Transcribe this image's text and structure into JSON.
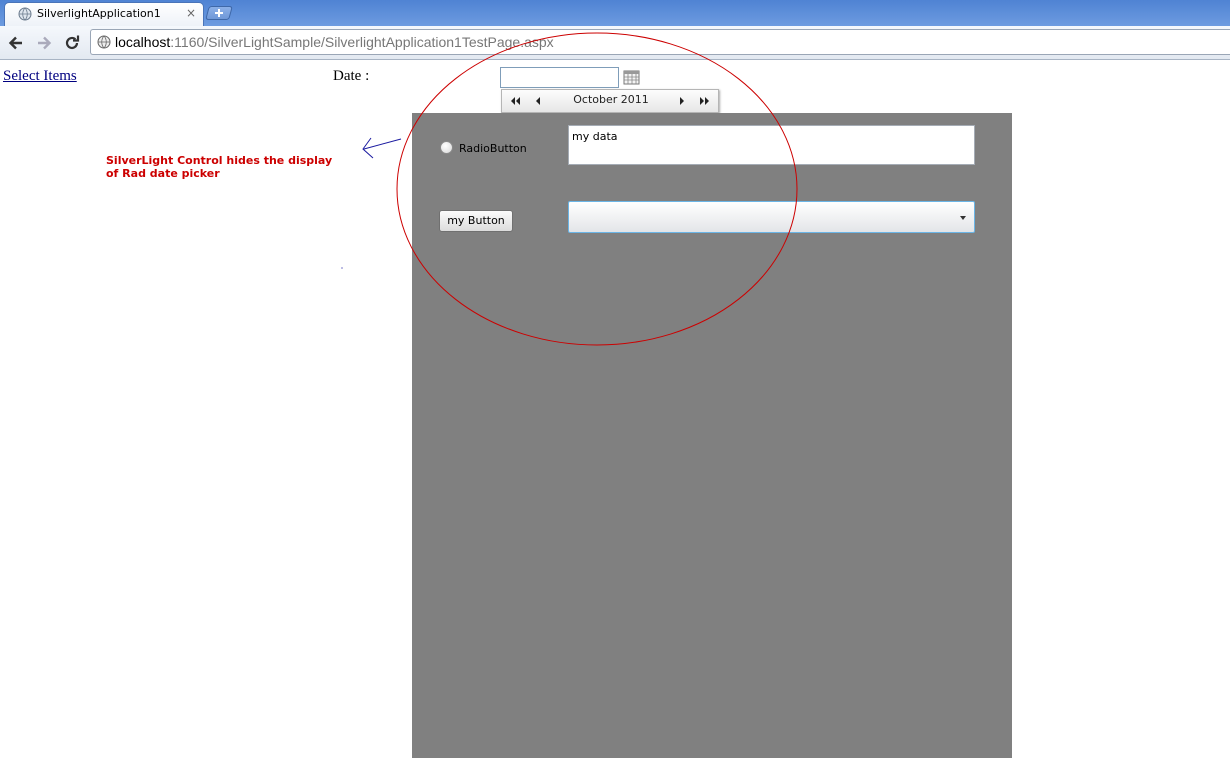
{
  "browser": {
    "tab_title": "SilverlightApplication1",
    "tab_close": "×",
    "address_host": "localhost",
    "address_path": ":1160/SilverLightSample/SilverlightApplication1TestPage.aspx"
  },
  "page": {
    "select_items_link": "Select Items",
    "date_label": "Date :",
    "date_value": "",
    "calendar": {
      "title": "October 2011"
    },
    "annotation_line1": "SilverLight Control hides the display",
    "annotation_line2": "of Rad date picker"
  },
  "silverlight": {
    "radio_label": "RadioButton",
    "textbox_value": "my data",
    "button_label": "my Button",
    "combo_value": ""
  },
  "colors": {
    "silverlight_bg": "#808080",
    "annotation": "#cc0000",
    "highlight_circle": "#cc0000",
    "arrow": "#1a1aa0"
  }
}
